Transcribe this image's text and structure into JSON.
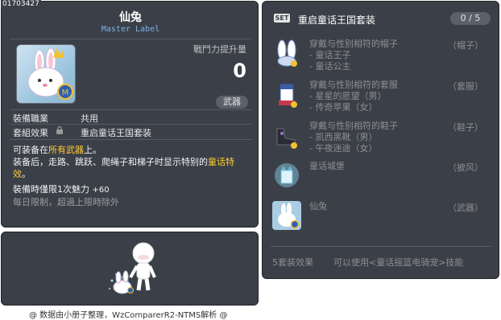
{
  "id_text": "01703427",
  "item": {
    "name": "仙兔",
    "subtitle": "Master Label",
    "power_label": "戰鬥力提升量",
    "power_value": "0",
    "category_button": "武器",
    "job_label": "裝備職業",
    "job_value": "共用",
    "set_label": "套組效果",
    "set_value": "重启童话王国套装",
    "desc_line1_a": "可装备在",
    "desc_line1_hl": "所有武器",
    "desc_line1_b": "上。",
    "desc_line2_a": "装备后，走路、跳跃、爬绳子和梯子时显示特别的",
    "desc_line2_hl": "童话特",
    "desc_line3_hl": "效",
    "desc_line3_b": "。",
    "desc_line4_a": "裝備時僅限1次魅力",
    "desc_line4_b": "+60",
    "desc_line5": "每日限制，超過上限時除外"
  },
  "footer": "@ 数据由小册子整理，WzComparerR2-NTMS解析 @",
  "set": {
    "badge": "SET",
    "title": "重启童话王国套装",
    "count": "0 / 5",
    "items": [
      {
        "name": "穿戴与性别相符的帽子",
        "type": "（帽子）",
        "sub": [
          "- 童话王子",
          "- 童话公主"
        ]
      },
      {
        "name": "穿戴与性别相符的套服",
        "type": "（套服）",
        "sub": [
          "- 星星的愿望（男）",
          "- 传奇苹果（女）"
        ]
      },
      {
        "name": "穿戴与性别相符的鞋子",
        "type": "（鞋子）",
        "sub": [
          "- 凯西黑靴（男）",
          "- 午夜迷途（女）"
        ]
      },
      {
        "name": "童话城堡",
        "type": "（披风）",
        "sub": []
      },
      {
        "name": "仙兔",
        "type": "（武器）",
        "sub": []
      }
    ],
    "effect_label": "5套装效果",
    "effect_value": "可以使用<童话摇篮电骑宠>技能"
  },
  "colors": {
    "panel_bg": "#3b4048",
    "highlight": "#ffcc33",
    "subtitle_blue": "#7fb2ec"
  }
}
